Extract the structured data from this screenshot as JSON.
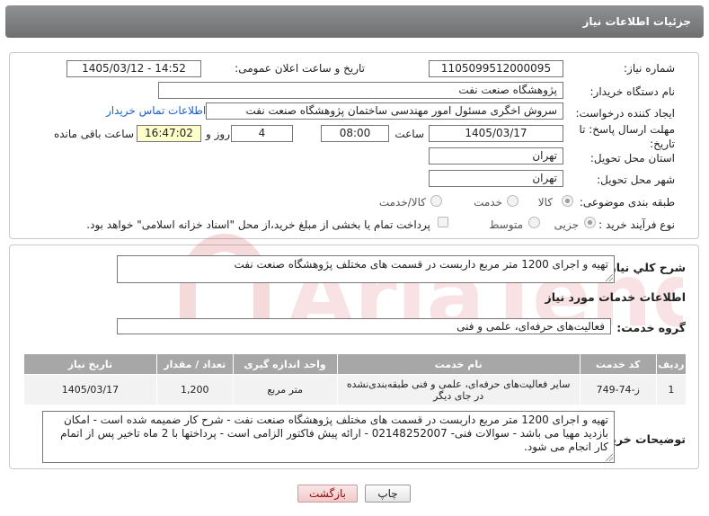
{
  "window": {
    "title": "جزئیات اطلاعات نیاز"
  },
  "labels": {
    "need_number": "شماره نیاز:",
    "announce_datetime": "تاریخ و ساعت اعلان عمومی:",
    "buyer_org": "نام دستگاه خریدار:",
    "requester": "ایجاد کننده درخواست:",
    "deadline": "مهلت ارسال پاسخ: تا تاریخ:",
    "time": "ساعت",
    "days_and": "روز و",
    "remaining": "ساعت باقی مانده",
    "delivery_province": "استان محل تحویل:",
    "delivery_city": "شهر محل تحویل:",
    "category": "طبقه بندی موضوعی:",
    "purchase_type": "نوع فرآیند خرید :",
    "general_desc": "شرح کلي نیاز:",
    "services_info": "اطلاعات خدمات مورد نیاز",
    "service_group": "گروه خدمت:",
    "buyer_notes": "توضیحات خریدار:"
  },
  "fields": {
    "need_number": "1105099512000095",
    "announce_datetime": "1405/03/12 - 14:52",
    "buyer_org": "پژوهشگاه صنعت نفت",
    "requester": "سروش اخگری مسئول امور مهندسی ساختمان پژوهشگاه صنعت نفت",
    "deadline_date": "1405/03/17",
    "deadline_time": "08:00",
    "days": "4",
    "remaining_time": "16:47:02",
    "delivery_province": "تهران",
    "delivery_city": "تهران",
    "general_desc": "تهیه و اجرای 1200 متر مربع داربست در قسمت های مختلف پژوهشگاه صنعت نفت",
    "service_group": "فعالیت‌های حرفه‌ای، علمی و فنی",
    "buyer_notes": "تهیه و اجرای 1200 متر مربع داربست در قسمت های مختلف پژوهشگاه صنعت نفت - شرح کار ضمیمه شده است - امکان بازدید مهیا می باشد - سوالات فنی- 02148252007 - ارائه پیش فاکتور الزامی است - پرداختها با 2 ماه تاخیر پس از اتمام کار انجام می شود."
  },
  "links": {
    "buyer_contact": "اطلاعات تماس خریدار"
  },
  "category_options": [
    "کالا",
    "خدمت",
    "کالا/خدمت"
  ],
  "purchase_options": [
    "جزیی",
    "متوسط"
  ],
  "payment_note": "پرداخت تمام یا بخشی از مبلغ خرید،از محل \"اسناد خزانه اسلامی\" خواهد بود.",
  "table": {
    "headers": [
      "ردیف",
      "کد خدمت",
      "نام خدمت",
      "واحد اندازه گیری",
      "تعداد / مقدار",
      "تاریخ نیاز"
    ],
    "rows": [
      [
        "1",
        "ز-74-749",
        "سایر فعالیت‌های حرفه‌ای، علمی و فنی طبقه‌بندی‌نشده در جای دیگر",
        "متر مربع",
        "1,200",
        "1405/03/17"
      ]
    ]
  },
  "buttons": {
    "print": "چاپ",
    "back": "بازگشت"
  },
  "watermark": {
    "text": "AriaTender.net"
  },
  "colors": {
    "title_bar": "#7f8082",
    "link": "#1a62c5",
    "remaining_bg": "#ffffcc",
    "table_header": "#a7a7a7"
  }
}
